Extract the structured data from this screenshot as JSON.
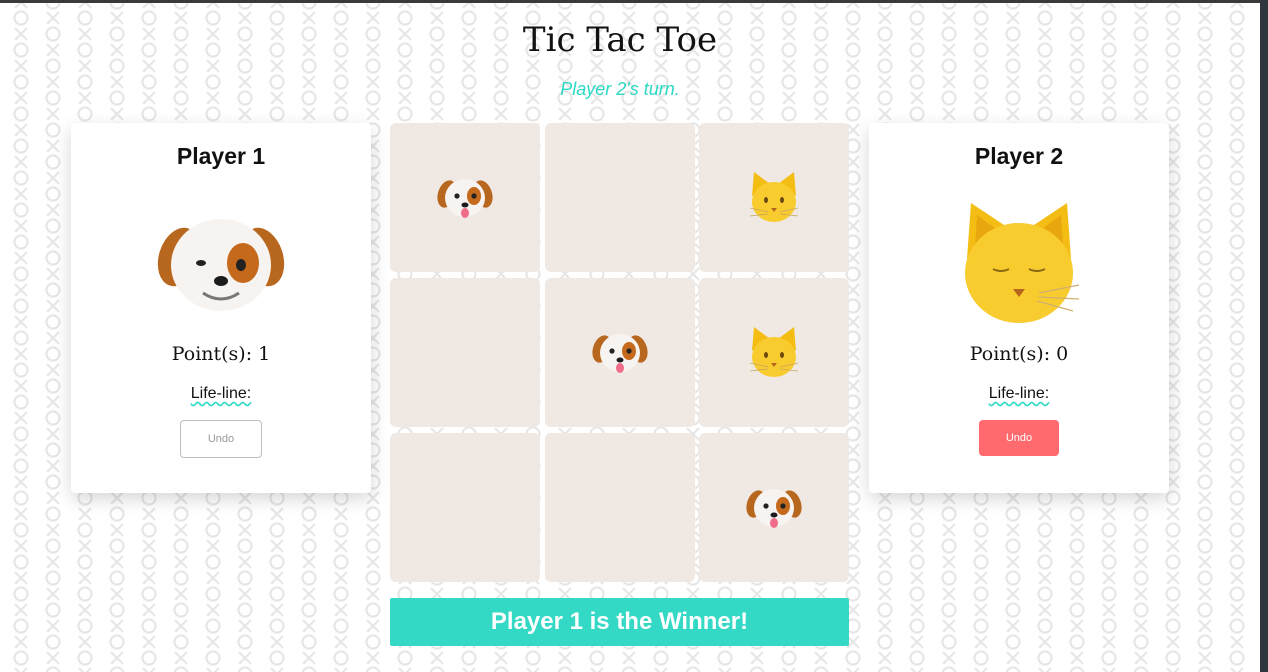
{
  "title": "Tic Tac Toe",
  "status": "Player 2's turn.",
  "players": [
    {
      "name": "Player 1",
      "avatar": "dog-emoji",
      "points_label": "Point(s): 1",
      "lifeline_label": "Life-line:",
      "undo_label": "Undo",
      "undo_enabled": false
    },
    {
      "name": "Player 2",
      "avatar": "cat-emoji",
      "points_label": "Point(s): 0",
      "lifeline_label": "Life-line:",
      "undo_label": "Undo",
      "undo_enabled": true
    }
  ],
  "board": [
    [
      "dog",
      "",
      "cat"
    ],
    [
      "",
      "dog",
      "cat"
    ],
    [
      "",
      "",
      "dog"
    ]
  ],
  "winner_banner": "Player 1 is the Winner!",
  "colors": {
    "accent": "#33d9c5",
    "undo_active": "#ff6a6f",
    "cell_bg": "#f0e9e3"
  }
}
